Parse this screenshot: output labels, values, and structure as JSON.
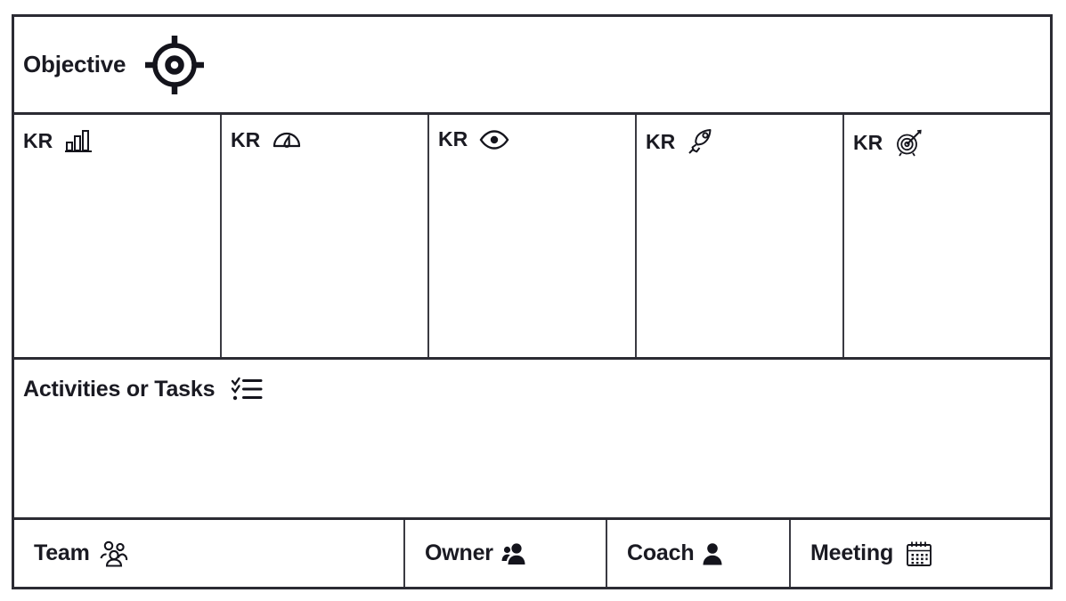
{
  "board": {
    "objective": {
      "label": "Objective",
      "icon": "crosshair-target-icon"
    },
    "key_results": [
      {
        "label": "KR",
        "icon": "bar-chart-icon"
      },
      {
        "label": "KR",
        "icon": "gauge-icon"
      },
      {
        "label": "KR",
        "icon": "eye-icon"
      },
      {
        "label": "KR",
        "icon": "rocket-icon"
      },
      {
        "label": "KR",
        "icon": "dartboard-arrow-icon"
      }
    ],
    "activities": {
      "label": "Activities or Tasks",
      "icon": "checklist-icon"
    },
    "footer": [
      {
        "label": "Team",
        "icon": "people-group-icon"
      },
      {
        "label": "Owner",
        "icon": "two-people-filled-icon"
      },
      {
        "label": "Coach",
        "icon": "person-filled-icon"
      },
      {
        "label": "Meeting",
        "icon": "calendar-icon"
      }
    ]
  },
  "colors": {
    "border": "#2b2b33",
    "divider": "#3a3a42",
    "text": "#1a1a22",
    "background": "#ffffff"
  }
}
